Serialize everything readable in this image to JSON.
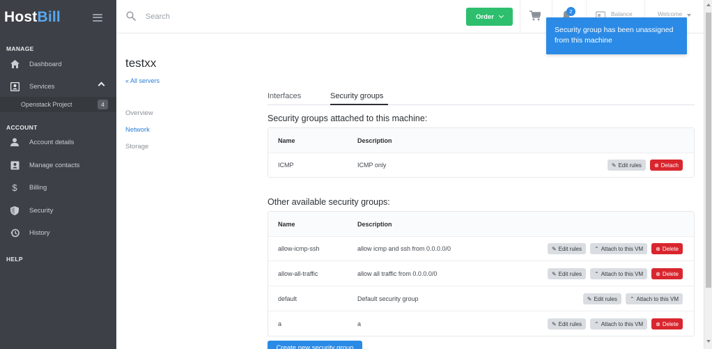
{
  "brand": {
    "part1": "Host",
    "part2": "Bill"
  },
  "sidebar": {
    "manage_title": "MANAGE",
    "account_title": "ACCOUNT",
    "help_title": "HELP",
    "items": [
      {
        "label": "Dashboard",
        "icon": "home-icon"
      },
      {
        "label": "Services",
        "icon": "services-icon"
      },
      {
        "label": "Account details",
        "icon": "person-icon"
      },
      {
        "label": "Manage contacts",
        "icon": "contacts-icon"
      },
      {
        "label": "Billing",
        "icon": "dollar-icon"
      },
      {
        "label": "Security",
        "icon": "shield-icon"
      },
      {
        "label": "History",
        "icon": "history-icon"
      }
    ],
    "subitem": {
      "label": "Openstack Project",
      "count": "4"
    }
  },
  "topbar": {
    "search_placeholder": "Search",
    "order_label": "Order",
    "notification_count": "2",
    "balance_label": "Balance",
    "welcome_label": "Welcome"
  },
  "toast": {
    "message": "Security group has been unassigned from this machine"
  },
  "page": {
    "title": "testxx",
    "back_link": "« All servers",
    "subnav": [
      "Overview",
      "Network",
      "Storage"
    ]
  },
  "tabs": [
    "Interfaces",
    "Security groups"
  ],
  "attached": {
    "heading": "Security groups attached to this machine:",
    "headers": {
      "name": "Name",
      "description": "Description"
    },
    "rows": [
      {
        "name": "ICMP",
        "description": "ICMP only"
      }
    ]
  },
  "available": {
    "heading": "Other available security groups:",
    "headers": {
      "name": "Name",
      "description": "Description"
    },
    "rows": [
      {
        "name": "allow-icmp-ssh",
        "description": "allow icmp and ssh from 0.0.0.0/0"
      },
      {
        "name": "allow-all-traffic",
        "description": "allow all traffic from 0.0.0.0/0"
      },
      {
        "name": "default",
        "description": "Default security group"
      },
      {
        "name": "a",
        "description": "a"
      }
    ]
  },
  "buttons": {
    "edit_rules": "Edit rules",
    "detach": "Detach",
    "attach": "Attach to this VM",
    "delete": "Delete",
    "create": "Create new security group"
  },
  "colors": {
    "sidebar_bg": "#3d4147",
    "accent_blue": "#2a8ae6",
    "order_green": "#2dbf6e",
    "danger_red": "#d9262e"
  }
}
